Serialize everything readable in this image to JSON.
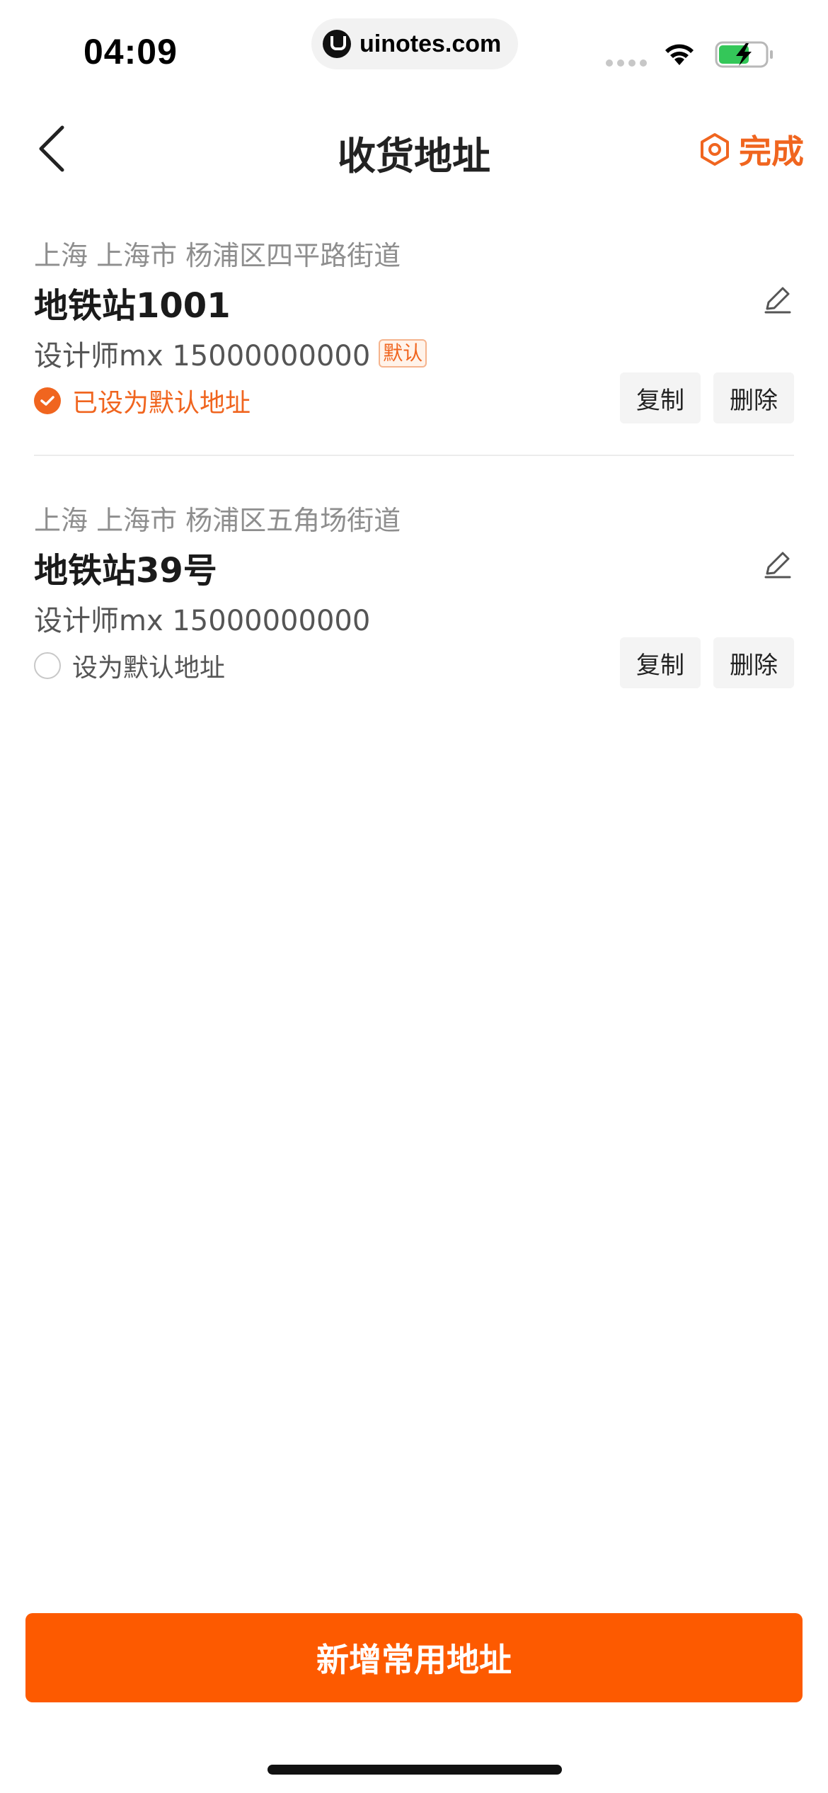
{
  "status_bar": {
    "time": "04:09",
    "url": "uinotes.com"
  },
  "nav": {
    "title": "收货地址",
    "done_label": "完成"
  },
  "addresses": [
    {
      "region": "上海 上海市 杨浦区四平路街道",
      "detail": "地铁站1001",
      "contact": "设计师mx 15000000000",
      "default_tag": "默认",
      "default_label": "已设为默认地址",
      "is_default": true,
      "copy_label": "复制",
      "delete_label": "删除"
    },
    {
      "region": "上海 上海市 杨浦区五角场街道",
      "detail": "地铁站39号",
      "contact": "设计师mx 15000000000",
      "default_label": "设为默认地址",
      "is_default": false,
      "copy_label": "复制",
      "delete_label": "删除"
    }
  ],
  "add_button_label": "新增常用地址",
  "colors": {
    "accent": "#f0651f",
    "primary_button": "#fd5a00"
  }
}
